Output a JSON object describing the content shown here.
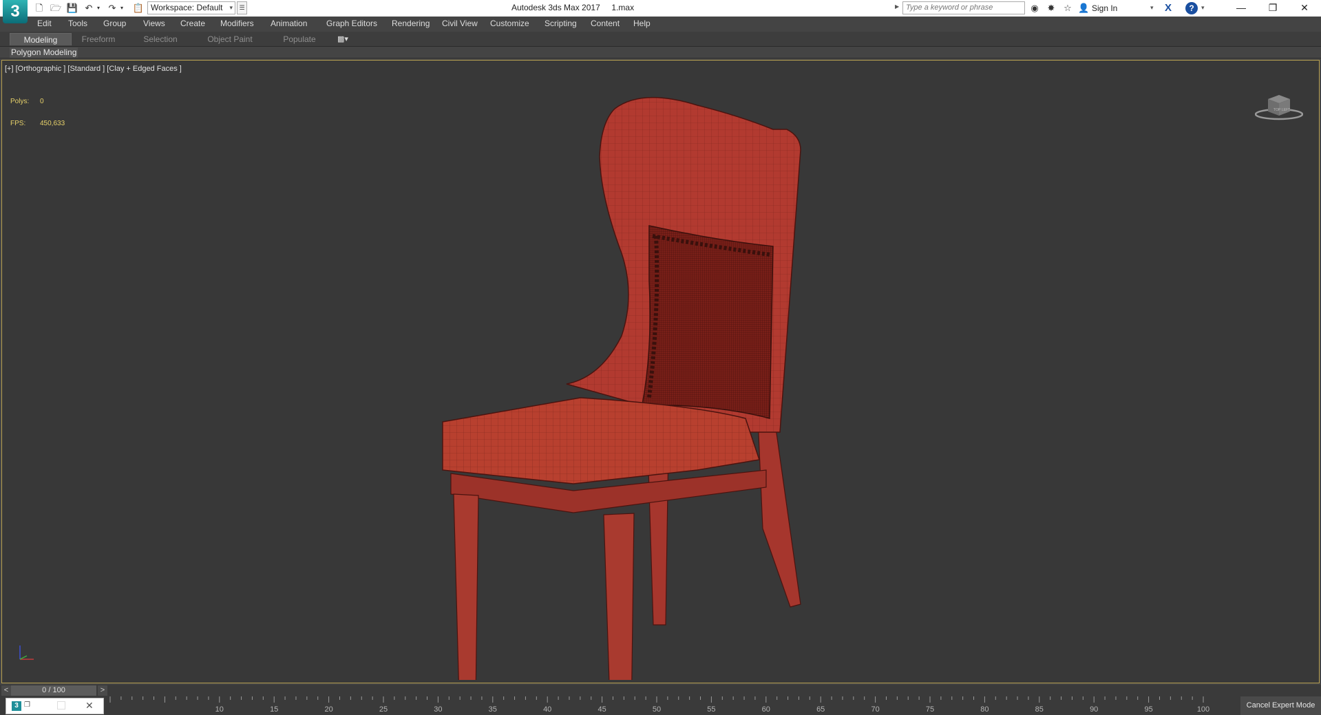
{
  "titlebar": {
    "workspace": "Workspace: Default",
    "title": "Autodesk 3ds Max 2017     1.max",
    "search_placeholder": "Type a keyword or phrase",
    "sign_in": "Sign In"
  },
  "menu": [
    "Edit",
    "Tools",
    "Group",
    "Views",
    "Create",
    "Modifiers",
    "Animation",
    "Graph Editors",
    "Rendering",
    "Civil View",
    "Customize",
    "Scripting",
    "Content",
    "Help"
  ],
  "ribbon": {
    "tabs": [
      "Modeling",
      "Freeform",
      "Selection",
      "Object Paint",
      "Populate"
    ],
    "active_tab": "Modeling",
    "panel": "Polygon Modeling"
  },
  "viewport": {
    "label": "[+] [Orthographic ] [Standard ] [Clay + Edged Faces ]",
    "polys_label": "Polys:",
    "polys_value": "0",
    "fps_label": "FPS:",
    "fps_value": "450,633",
    "viewcube_labels": [
      "TOP",
      "LEFT"
    ]
  },
  "timeline": {
    "position": "0 / 100",
    "prev": "<",
    "next": ">",
    "ticks": [
      "10",
      "15",
      "20",
      "25",
      "30",
      "35",
      "40",
      "45",
      "50",
      "55",
      "60",
      "65",
      "70",
      "75",
      "80",
      "85",
      "90",
      "95",
      "100"
    ]
  },
  "status": {
    "cancel_expert_mode": "Cancel Expert Mode"
  },
  "colors": {
    "chair": "#b23a30",
    "viewport_bg": "#383838",
    "viewport_border": "#b8a050",
    "stats": "#e8d26a"
  }
}
